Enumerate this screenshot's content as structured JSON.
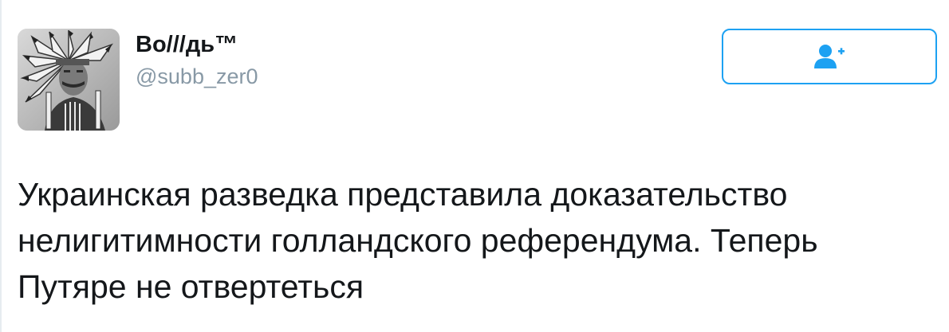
{
  "user": {
    "display_name": "Bo///дь™",
    "handle": "@subb_zer0",
    "avatar_icon": "profile-photo"
  },
  "follow_button": {
    "icon": "follow-user-plus-icon",
    "accent_color": "#1da1f2"
  },
  "tweet": {
    "text_lines": [
      "Украинская разведка представила доказательство",
      "нелигитимности голландского референдума. Теперь",
      "Путяре не отвертеться"
    ]
  }
}
